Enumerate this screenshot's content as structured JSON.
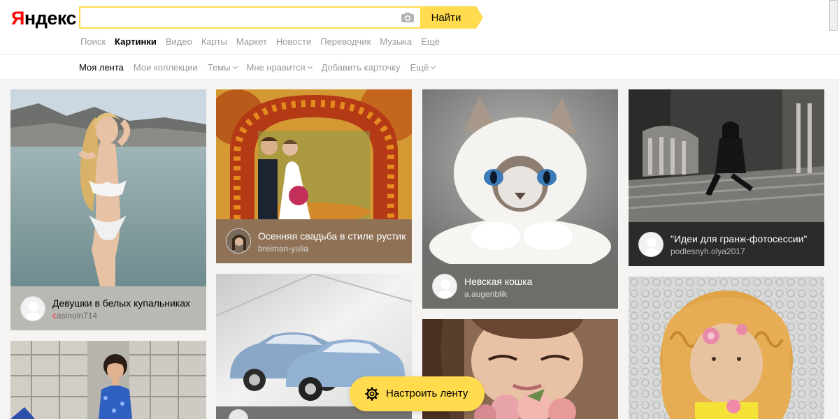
{
  "header": {
    "logo_first": "Я",
    "logo_rest": "ндекс",
    "search_value": "",
    "find_label": "Найти",
    "services": [
      "Поиск",
      "Картинки",
      "Видео",
      "Карты",
      "Маркет",
      "Новости",
      "Переводчик",
      "Музыка",
      "Ещё"
    ],
    "active_service": "Картинки"
  },
  "subnav": {
    "items": [
      "Моя лента",
      "Мои коллекции",
      "Темы",
      "Мне нравится",
      "Добавить карточку",
      "Ещё"
    ],
    "active": "Моя лента"
  },
  "cards": [
    {
      "title": "Девушки в белых купальниках",
      "author_first": "c",
      "author_rest": "asinoln714",
      "scene": "woman-bikini-lake"
    },
    {
      "title": "Осенняя свадьба в стиле рустик",
      "author": "breiman-yulia",
      "scene": "wedding-autumn-arch"
    },
    {
      "title": "Невская кошка",
      "author": "a.augenblik",
      "scene": "white-cat"
    },
    {
      "title": "\"Идеи для гранж-фотосессии\"",
      "author": "podlesnyh.olya2017",
      "scene": "woman-stairs"
    },
    {
      "scene": "girl-blue-dress"
    },
    {
      "scene": "blue-cars"
    },
    {
      "scene": "woman-flowers"
    },
    {
      "scene": "doll"
    }
  ],
  "fab": {
    "label": "Настроить ленту"
  },
  "colors": {
    "accent": "#ffdb4d",
    "logo_red": "#ff0000",
    "author_red": "#f04040"
  }
}
